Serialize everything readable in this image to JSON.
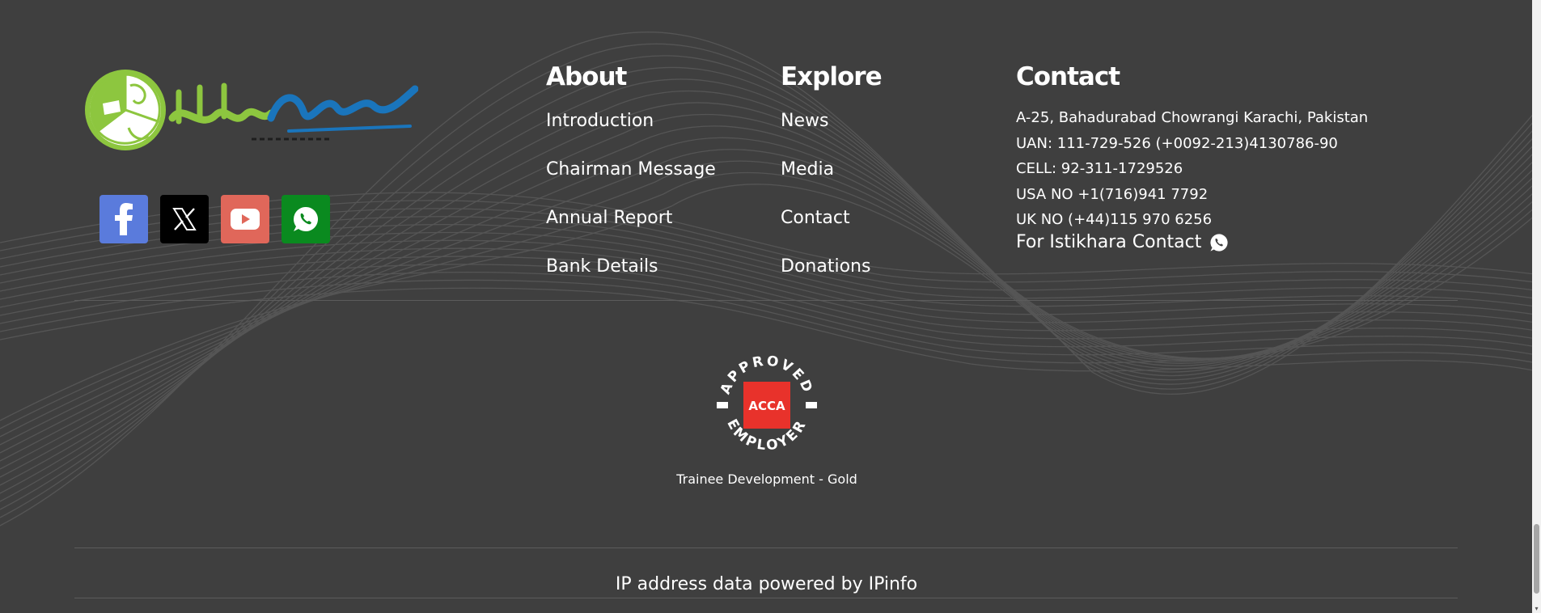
{
  "brand": {
    "logo_label": "Saylani",
    "colors": {
      "green": "#8dc63f",
      "blue": "#1a75bc",
      "background": "#3f3f3f"
    }
  },
  "social": [
    {
      "name": "facebook",
      "icon": "facebook-icon",
      "color": "#5a7bdc"
    },
    {
      "name": "x",
      "icon": "x-icon",
      "color": "#000000"
    },
    {
      "name": "youtube",
      "icon": "youtube-icon",
      "color": "#e0675a"
    },
    {
      "name": "whatsapp",
      "icon": "whatsapp-icon",
      "color": "#0a8a1f"
    }
  ],
  "about": {
    "title": "About",
    "links": [
      "Introduction",
      "Chairman Message",
      "Annual Report",
      "Bank Details"
    ]
  },
  "explore": {
    "title": "Explore",
    "links": [
      "News",
      "Media",
      "Contact",
      "Donations"
    ]
  },
  "contact": {
    "title": "Contact",
    "lines": [
      "A-25, Bahadurabad Chowrangi Karachi, Pakistan",
      "UAN: 111-729-526 (+0092-213)4130786-90",
      "CELL: 92-311-1729526",
      "USA NO +1(716)941 7792",
      "UK NO (+44)115 970 6256"
    ],
    "istikhara": "For Istikhara Contact",
    "istikhara_icon": "whatsapp-icon"
  },
  "acca": {
    "top_text": "APPROVED",
    "center_text": "ACCA",
    "bottom_text": "EMPLOYER",
    "caption": "Trainee Development - Gold",
    "color": "#e8322b"
  },
  "footer": {
    "powered_by": "IP address data powered by IPinfo"
  }
}
